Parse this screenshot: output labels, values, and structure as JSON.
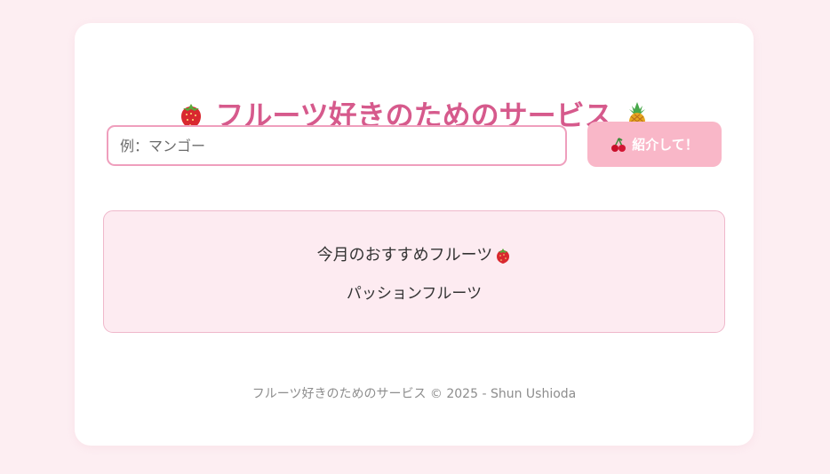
{
  "app": {
    "title": "フルーツ好きのためのサービス"
  },
  "search": {
    "placeholder": "例：マンゴー",
    "value": ""
  },
  "button": {
    "label": "紹介して！",
    "icon": "cherry-icon"
  },
  "recommendation": {
    "heading": "今月のおすすめフルーツ",
    "fruit": "パッションフルーツ",
    "heading_icon": "strawberry-icon"
  },
  "footer": {
    "text": "フルーツ好きのためのサービス © 2025 - Shun Ushioda"
  },
  "icons": {
    "title_left": "strawberry-icon",
    "title_right": "pineapple-icon"
  },
  "colors": {
    "page_background": "#fdeef2",
    "card_background": "#ffffff",
    "title": "#d65a8c",
    "input_border": "#ef9fbd",
    "button_background": "#f9b7c8",
    "recommend_background": "#fdebf1",
    "recommend_border": "#efb8cb",
    "footer_text": "#8d8d8d"
  }
}
